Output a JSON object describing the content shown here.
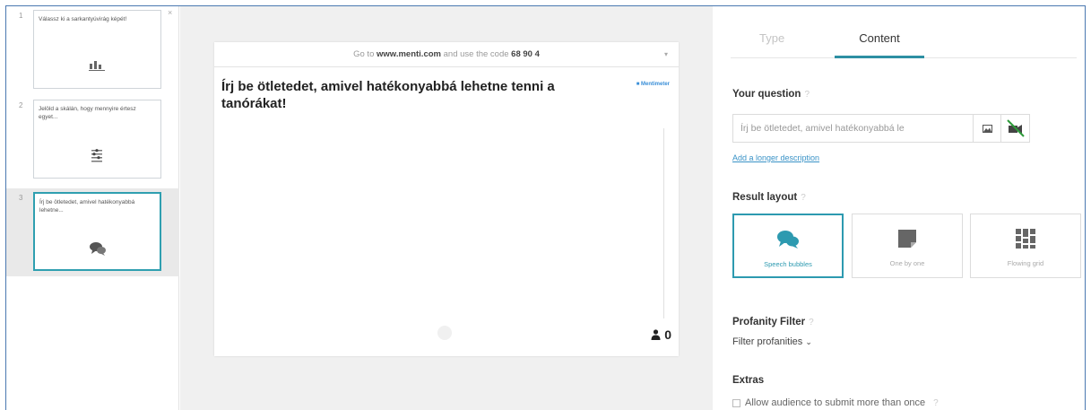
{
  "slides": [
    {
      "number": "1",
      "title": "Válassz ki a sarkantyúvirág képét!",
      "icon": "bar-chart-icon"
    },
    {
      "number": "2",
      "title": "Jelöld a skálán, hogy mennyire értesz egyet...",
      "icon": "scales-icon"
    },
    {
      "number": "3",
      "title": "Írj be ötletedet, amivel hatékonyabbá lehetne...",
      "icon": "speech-bubbles-icon"
    }
  ],
  "preview": {
    "code_prefix": "Go to",
    "code_url": "www.menti.com",
    "code_middle": "and use the code",
    "code_value": "68 90 4",
    "question": "Írj be ötletedet, amivel hatékonyabbá lehetne tenni a tanórákat!",
    "brand": "Mentimeter",
    "audience_count": "0"
  },
  "panel": {
    "tabs": [
      "Type",
      "Content"
    ],
    "active_tab": "Content",
    "question_label": "Your question",
    "help_mark": "?",
    "question_value": "Írj be ötletedet, amivel hatékonyabbá le",
    "add_description": "Add a longer description",
    "result_layout_label": "Result layout",
    "layouts": [
      {
        "label": "Speech bubbles",
        "icon": "speech-bubbles-icon",
        "selected": true
      },
      {
        "label": "One by one",
        "icon": "note-icon",
        "selected": false
      },
      {
        "label": "Flowing grid",
        "icon": "grid-icon",
        "selected": false
      }
    ],
    "profanity_label": "Profanity Filter",
    "profanity_value": "Filter profanities",
    "extras_label": "Extras",
    "extras_checkbox": "Allow audience to submit more than once"
  },
  "colors": {
    "accent": "#2d9ab0",
    "link": "#3a93c7"
  }
}
